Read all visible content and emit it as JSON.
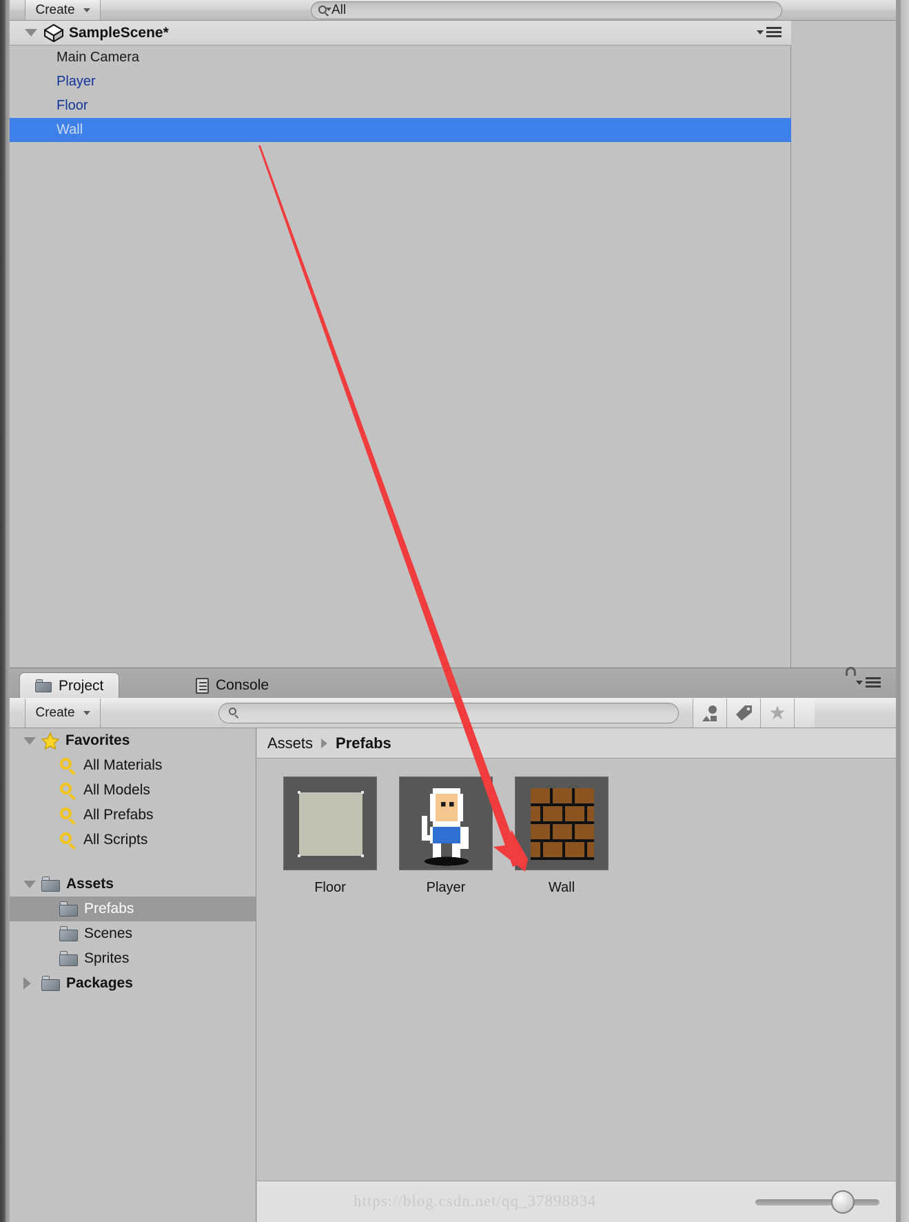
{
  "window": {
    "app": "Unity Editor",
    "watermark": "https://blog.csdn.net/qq_37898834"
  },
  "hierarchy": {
    "toolbar": {
      "create_label": "Create",
      "create_icon": "chevron-down-icon",
      "search_value": "All",
      "search_icon": "search-dropdown-icon"
    },
    "scene": {
      "name": "SampleScene*",
      "icon": "unity-scene-icon",
      "expanded": true,
      "expand_icon": "triangle-down-icon",
      "menu_icon": "panel-menu-icon"
    },
    "items": [
      {
        "label": "Main Camera",
        "type": "gameobject",
        "selected": false
      },
      {
        "label": "Player",
        "type": "prefab",
        "selected": false
      },
      {
        "label": "Floor",
        "type": "prefab",
        "selected": false
      },
      {
        "label": "Wall",
        "type": "prefab",
        "selected": true
      }
    ]
  },
  "bottom_panel": {
    "tabs": [
      {
        "label": "Project",
        "icon": "folder-icon",
        "active": true
      },
      {
        "label": "Console",
        "icon": "document-icon",
        "active": false
      }
    ],
    "lock_icon": "lock-open-icon",
    "menu_icon": "panel-menu-icon",
    "toolbar": {
      "create_label": "Create",
      "create_icon": "chevron-down-icon",
      "search_value": "",
      "search_placeholder": "",
      "search_icon": "search-icon",
      "filter_buttons": [
        {
          "name": "type-filter",
          "icon": "asset-type-icon"
        },
        {
          "name": "label-filter",
          "icon": "tag-icon"
        },
        {
          "name": "favorite-filter",
          "icon": "star-icon"
        }
      ]
    },
    "tree": {
      "favorites": {
        "label": "Favorites",
        "icon": "star-icon",
        "expanded": true,
        "expand_icon": "triangle-down-icon",
        "children": [
          {
            "label": "All Materials",
            "icon": "search-icon"
          },
          {
            "label": "All Models",
            "icon": "search-icon"
          },
          {
            "label": "All Prefabs",
            "icon": "search-icon"
          },
          {
            "label": "All Scripts",
            "icon": "search-icon"
          }
        ]
      },
      "assets": {
        "label": "Assets",
        "icon": "folder-icon",
        "expanded": true,
        "expand_icon": "triangle-down-icon",
        "children": [
          {
            "label": "Prefabs",
            "icon": "folder-icon",
            "selected": true
          },
          {
            "label": "Scenes",
            "icon": "folder-icon",
            "selected": false
          },
          {
            "label": "Sprites",
            "icon": "folder-icon",
            "selected": false
          }
        ]
      },
      "packages": {
        "label": "Packages",
        "icon": "folder-icon",
        "expanded": false,
        "expand_icon": "triangle-right-icon"
      }
    },
    "breadcrumb": {
      "root": "Assets",
      "separator_icon": "breadcrumb-arrow-icon",
      "current": "Prefabs"
    },
    "assets": [
      {
        "name": "Floor",
        "thumb": "floor-sprite"
      },
      {
        "name": "Player",
        "thumb": "player-sprite"
      },
      {
        "name": "Wall",
        "thumb": "wall-brick-sprite"
      }
    ]
  },
  "colors": {
    "selection_blue": "#3e7fe8",
    "prefab_blue": "#12359a",
    "tree_selection_gray": "#9a9a9a",
    "favorite_yellow": "#f2c319",
    "annotation_red": "#f03c3c",
    "panel_bg": "#c2c2c2",
    "brick_brown": "#8a5420",
    "player_shirt_blue": "#2f6fd0",
    "floor_beige": "#c3c1b4"
  },
  "annotation": {
    "type": "arrow",
    "from_label": "Wall",
    "to_label": "Wall",
    "color": "#f03c3c"
  }
}
